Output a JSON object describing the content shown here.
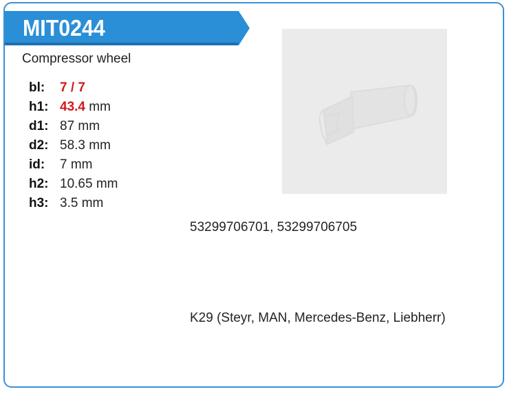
{
  "product": {
    "code": "MIT0244",
    "name": "Compressor wheel",
    "accent_color": "#2a8fd6"
  },
  "specs": [
    {
      "key": "bl:",
      "value": "7 / 7",
      "unit": "",
      "highlight": true
    },
    {
      "key": "h1:",
      "value": "43.4",
      "unit": " mm",
      "highlight": true
    },
    {
      "key": "d1:",
      "value": "87 mm",
      "unit": "",
      "highlight": false
    },
    {
      "key": "d2:",
      "value": "58.3 mm",
      "unit": "",
      "highlight": false
    },
    {
      "key": "id:",
      "value": "7 mm",
      "unit": "",
      "highlight": false
    },
    {
      "key": "h2:",
      "value": "10.65 mm",
      "unit": "",
      "highlight": false
    },
    {
      "key": "h3:",
      "value": "3.5 mm",
      "unit": "",
      "highlight": false
    }
  ],
  "oem_numbers": "53299706701, 53299706705",
  "applications": "K29 (Steyr, MAN, Mercedes-Benz, Liebherr)",
  "image": {
    "icon": "compressor-wheel-photo-placeholder"
  }
}
